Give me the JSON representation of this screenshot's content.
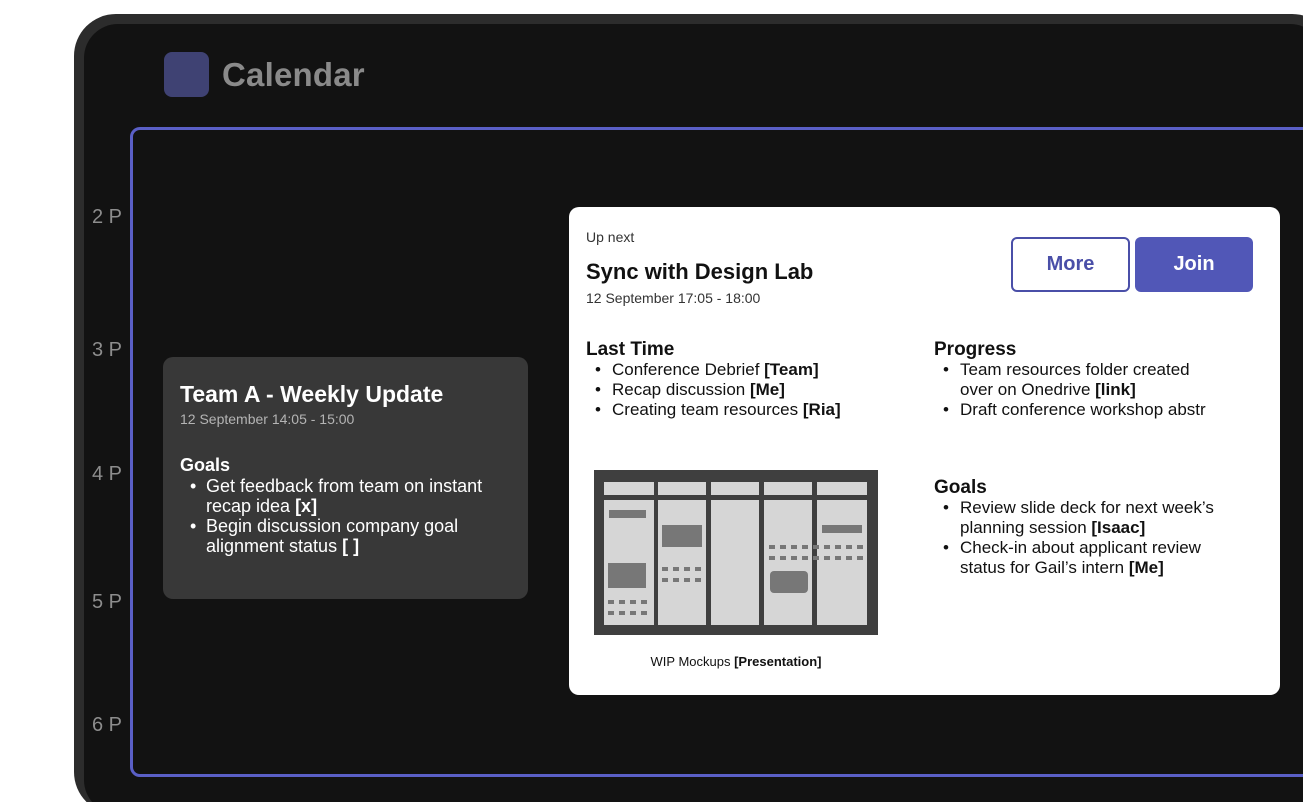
{
  "app": {
    "title": "Calendar"
  },
  "time_labels": [
    "2 P",
    "3 P",
    "4 P",
    "5 P",
    "6 P"
  ],
  "event": {
    "title": "Team A - Weekly Update",
    "time": "12 September 14:05 - 15:00",
    "goals_heading": "Goals",
    "goals": [
      {
        "text": "Get feedback from team on instant recap idea ",
        "tag": "[x]"
      },
      {
        "text": "Begin discussion company goal alignment status ",
        "tag": "[ ]"
      }
    ]
  },
  "next": {
    "label": "Up next",
    "title": "Sync with Design Lab",
    "time": "12 September 17:05 - 18:00",
    "more_label": "More",
    "join_label": "Join",
    "last_time": {
      "heading": "Last Time",
      "items": [
        {
          "text": "Conference Debrief ",
          "tag": "[Team]"
        },
        {
          "text": "Recap discussion ",
          "tag": "[Me]"
        },
        {
          "text": "Creating team resources ",
          "tag": "[Ria]"
        }
      ]
    },
    "progress": {
      "heading": "Progress",
      "item1_line1": "Team resources folder created",
      "item1_line2": "over on Onedrive ",
      "item1_tag": "[link]",
      "item2": "Draft conference workshop abstr"
    },
    "goals": {
      "heading": "Goals",
      "item1_line1": "Review slide deck for next week’s",
      "item1_line2": "planning session ",
      "item1_tag": "[Isaac]",
      "item2_line1": "Check-in about applicant review",
      "item2_line2": "status for Gail’s intern ",
      "item2_tag": "[Me]"
    },
    "attachment": {
      "caption": "WIP Mockups ",
      "tag": "[Presentation]"
    }
  }
}
